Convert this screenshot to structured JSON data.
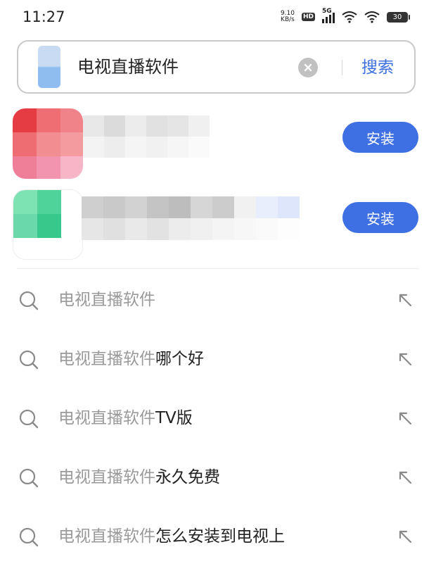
{
  "status_bar": {
    "time": "11:27",
    "net_speed_value": "9.10",
    "net_speed_unit": "KB/s",
    "hd_label": "HD",
    "network_label": "5G",
    "battery": "30"
  },
  "search": {
    "query": "电视直播软件",
    "submit_label": "搜索"
  },
  "apps": [
    {
      "install_label": "安装"
    },
    {
      "install_label": "安装"
    }
  ],
  "suggestions": [
    {
      "prefix": "电视直播软件",
      "suffix": ""
    },
    {
      "prefix": "电视直播软件",
      "suffix": "哪个好"
    },
    {
      "prefix": "电视直播软件",
      "suffix": "TV版"
    },
    {
      "prefix": "电视直播软件",
      "suffix": "永久免费"
    },
    {
      "prefix": "电视直播软件",
      "suffix": "怎么安装到电视上"
    }
  ],
  "colors": {
    "accent": "#3e6fe3",
    "link": "#3d6fe0",
    "muted_text": "#9a9a9a"
  },
  "icons": {
    "clear": "clear-icon",
    "query": "search-icon",
    "fill": "arrow-up-left-icon"
  }
}
